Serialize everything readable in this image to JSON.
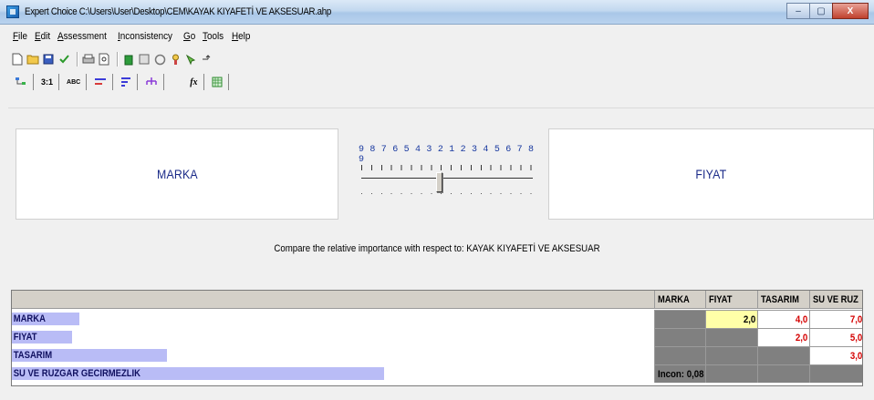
{
  "window": {
    "title": "Expert Choice    C:\\Users\\User\\Desktop\\CEM\\KAYAK KIYAFETİ VE AKSESUAR.ahp",
    "minimize_label": "–",
    "maximize_label": "▢",
    "close_label": "X"
  },
  "menu": {
    "items": [
      {
        "accel": "F",
        "rest": "ile"
      },
      {
        "accel": "E",
        "rest": "dit"
      },
      {
        "accel": "A",
        "rest": "ssessment"
      },
      {
        "accel": "I",
        "rest": "nconsistency"
      },
      {
        "accel": "G",
        "rest": "o"
      },
      {
        "accel": "T",
        "rest": "ools"
      },
      {
        "accel": "H",
        "rest": "elp"
      }
    ]
  },
  "toolbar": {
    "icons": [
      "new-file-icon",
      "open-folder-icon",
      "save-icon",
      "check-icon",
      "print-icon",
      "print-preview-icon",
      "delete-icon",
      "grid-icon",
      "model-icon",
      "wizard-icon",
      "pointer-icon",
      "arrow-up-icon"
    ]
  },
  "mode_tabs": {
    "tab1": "",
    "tab2": "3:1",
    "tab3": "ABC",
    "tab4": "",
    "tab5": "",
    "tab6": "",
    "tab7": "fx",
    "tab8": ""
  },
  "compare": {
    "left_element": "MARKA",
    "right_element": "FIYAT",
    "scale_numbers": "9 8 7 6 5 4 3 2 1 2 3 4 5 6 7 8 9",
    "slider_value": 2,
    "slider_toward": "FIYAT",
    "prompt": "Compare the relative importance with respect to: KAYAK KIYAFETİ VE AKSESUAR"
  },
  "matrix": {
    "columns": [
      "MARKA",
      "FIYAT",
      "TASARIM",
      "SU VE RUZ"
    ],
    "rows": [
      {
        "label": "MARKA",
        "bar_fraction": 0.1,
        "cells": [
          "",
          "2,0",
          "4,0",
          "7,0"
        ]
      },
      {
        "label": "FIYAT",
        "bar_fraction": 0.095,
        "cells": [
          "",
          "",
          "2,0",
          "5,0"
        ]
      },
      {
        "label": "TASARIM",
        "bar_fraction": 0.243,
        "cells": [
          "",
          "",
          "",
          "3,0"
        ]
      },
      {
        "label": "SU VE RUZGAR GECIRMEZLIK",
        "bar_fraction": 0.58,
        "cells": [
          "Incon: 0,08",
          "",
          "",
          ""
        ]
      }
    ],
    "colors": {
      "bar": "#b9bcf6",
      "selected": "#ffffa8",
      "inverse_value": "#d40000",
      "diagonal": "#808080"
    }
  }
}
